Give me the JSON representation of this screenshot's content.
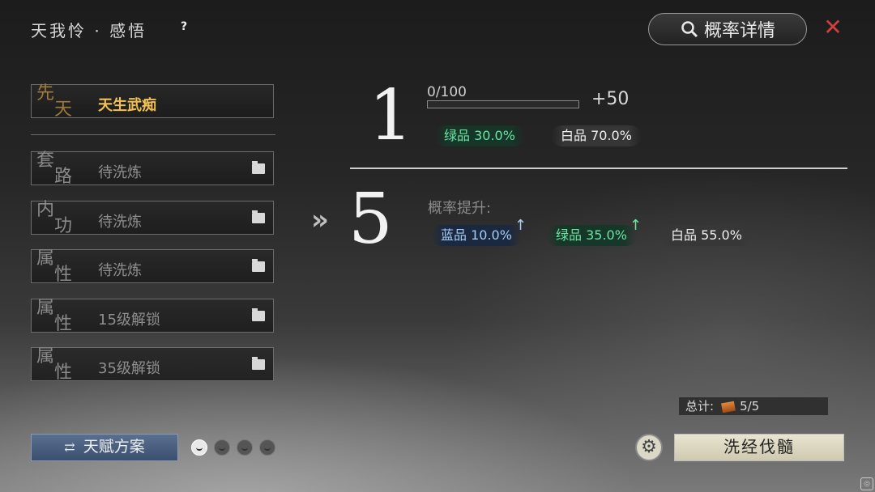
{
  "header": {
    "title": "天我怜 · 感悟",
    "help": "?",
    "prob_button": "概率详情",
    "close": "✕"
  },
  "slots": [
    {
      "big1": "先",
      "big2": "天",
      "name": "天生武痴"
    },
    {
      "big1": "套",
      "big2": "路",
      "name": "待洗炼"
    },
    {
      "big1": "内",
      "big2": "功",
      "name": "待洗炼"
    },
    {
      "big1": "属",
      "big2": "性",
      "name": "待洗炼"
    },
    {
      "big1": "属",
      "big2": "性",
      "name": "15级解锁"
    },
    {
      "big1": "属",
      "big2": "性",
      "name": "35级解锁"
    }
  ],
  "current": {
    "level": "1",
    "progress_text": "0/100",
    "progress": 0,
    "plus": "+50",
    "odds": [
      {
        "label": "绿品 30.0%",
        "color": "green"
      },
      {
        "label": "白品 70.0%",
        "color": "white"
      }
    ]
  },
  "next": {
    "arrows": "»",
    "level": "5",
    "boost_label": "概率提升:",
    "odds": [
      {
        "label": "蓝品 10.0%",
        "color": "blue",
        "up": "↑"
      },
      {
        "label": "绿品 35.0%",
        "color": "green",
        "up": "↑"
      },
      {
        "label": "白品 55.0%",
        "color": "white"
      }
    ]
  },
  "total": {
    "label": "总计:",
    "value": "5/5"
  },
  "footer": {
    "plan_button": "天赋方案",
    "wash_button": "洗经伐髓"
  },
  "colors": {
    "gold": "#f0c050",
    "green": "#6ee3a2",
    "blue": "#a7cdf5"
  }
}
